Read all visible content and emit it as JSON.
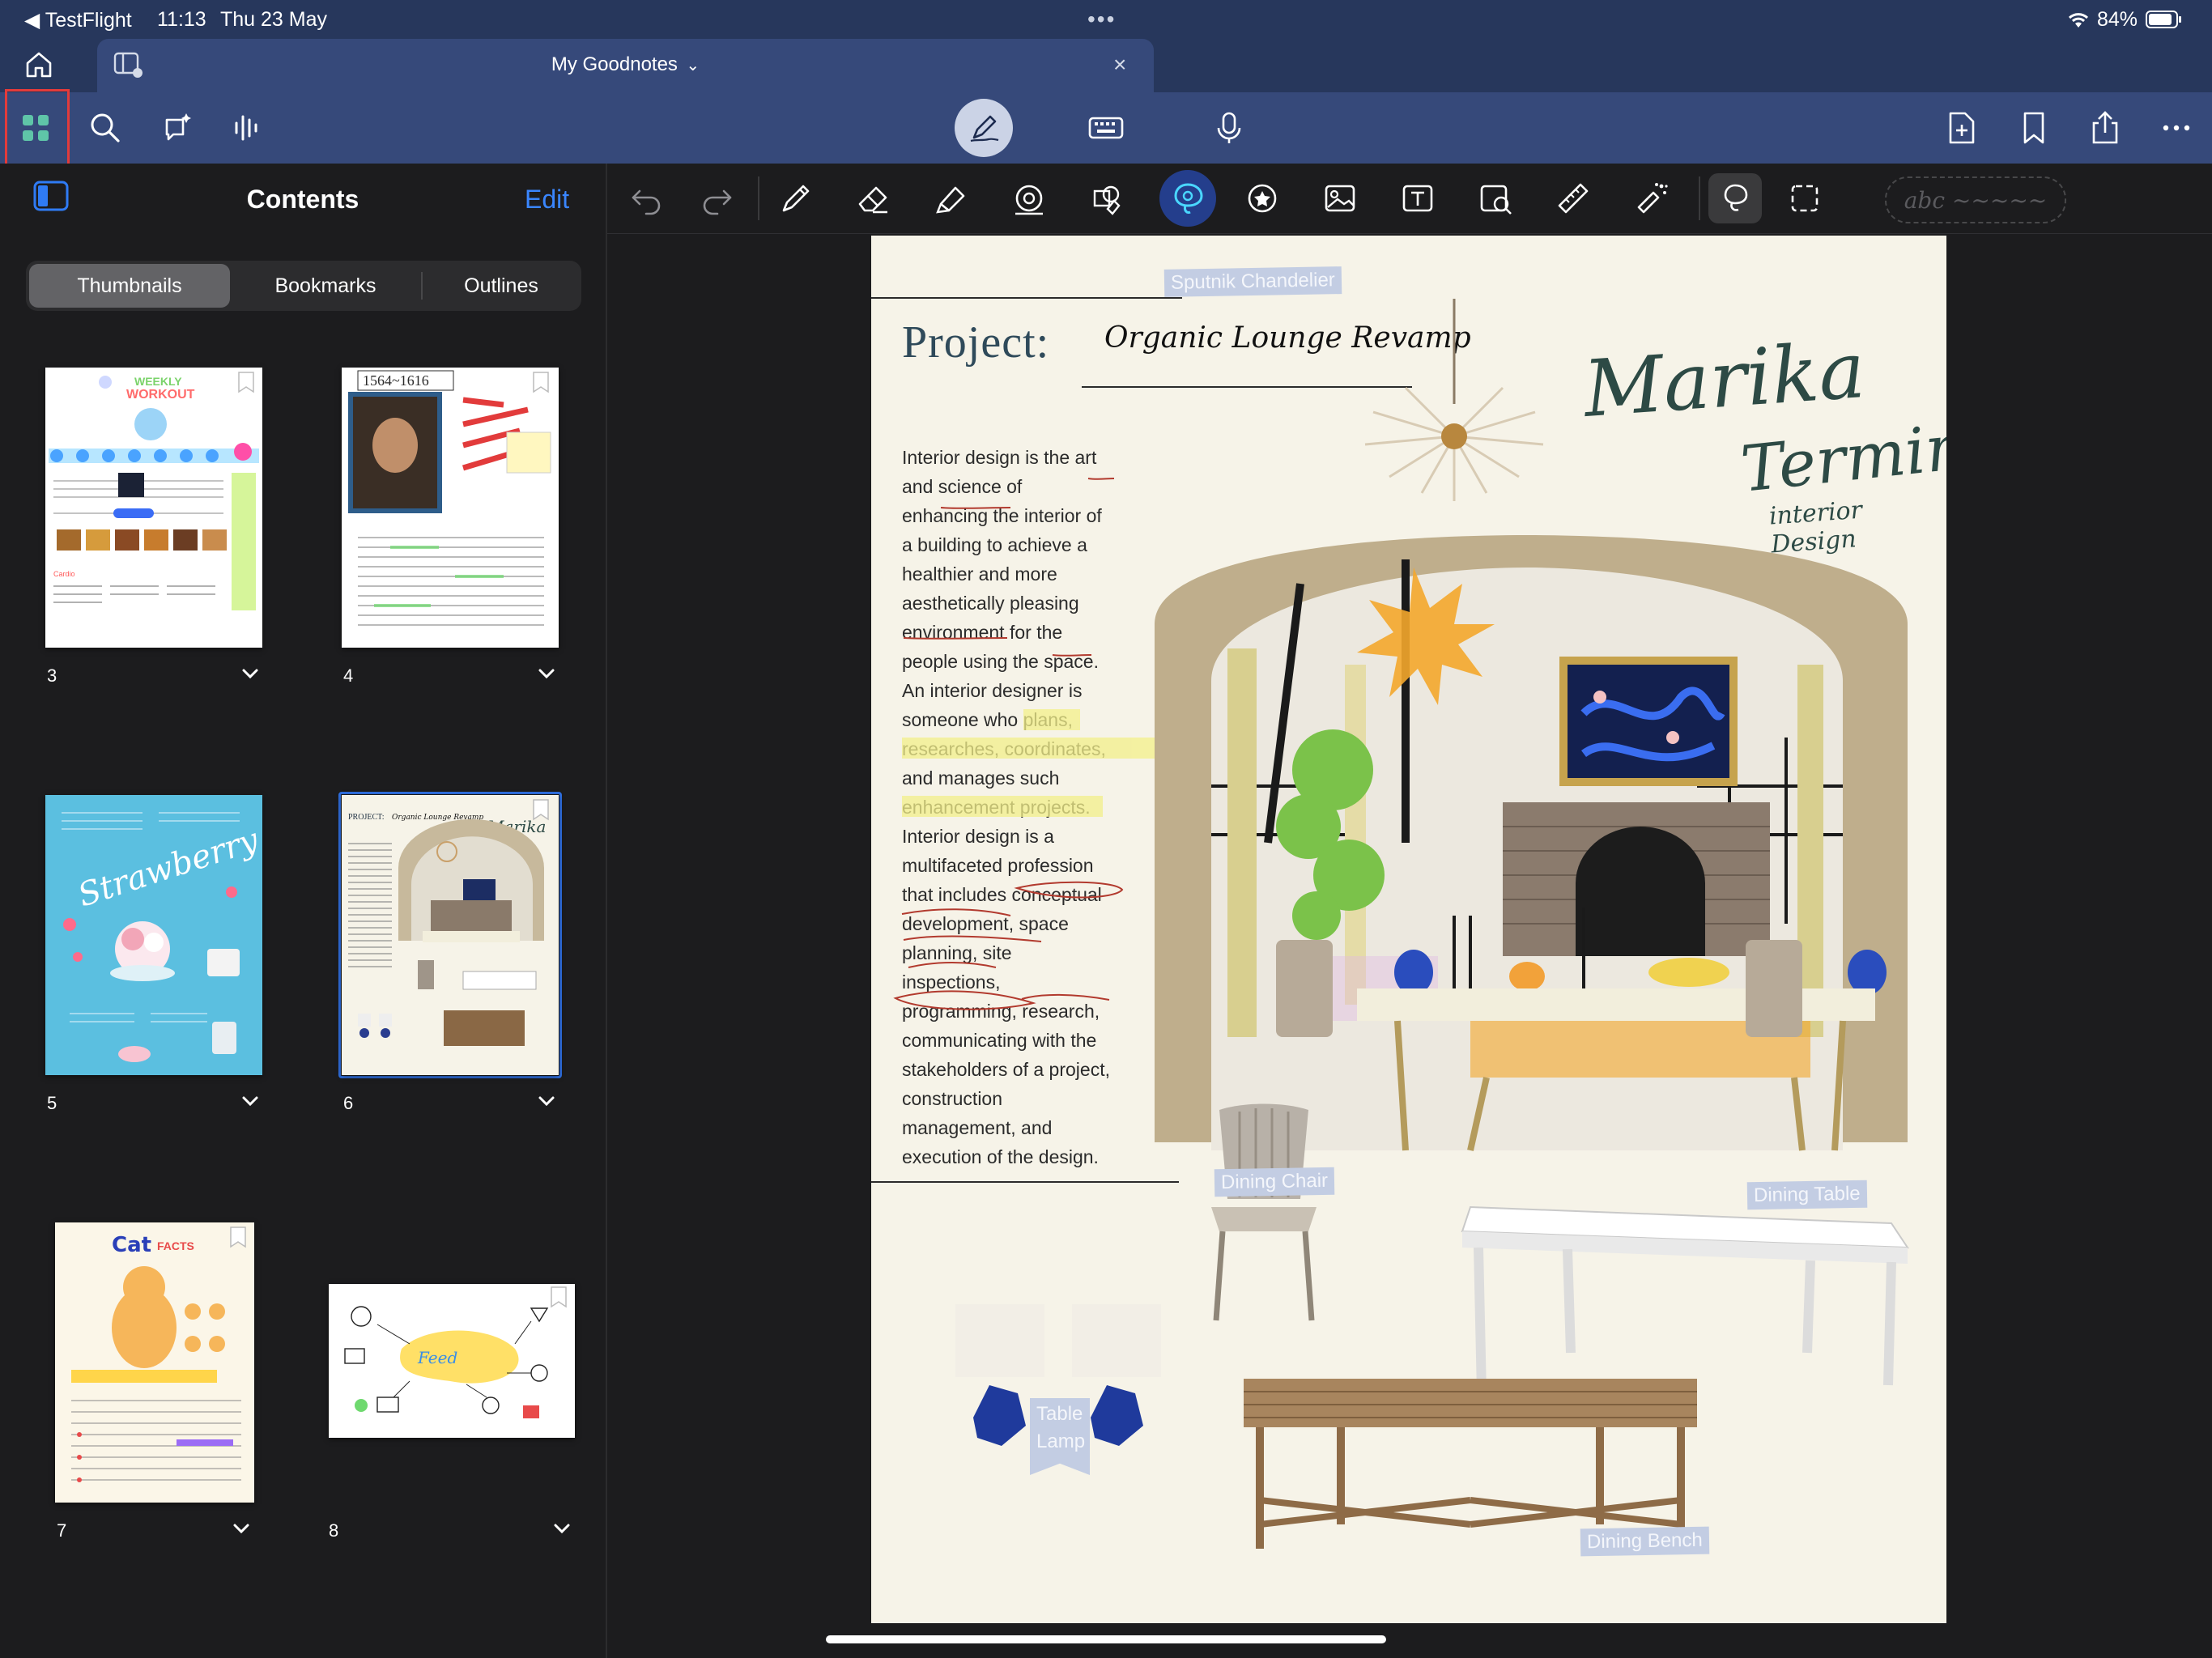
{
  "status_bar": {
    "back_app": "TestFlight",
    "time": "11:13",
    "date": "Thu 23 May",
    "battery": "84%"
  },
  "tab": {
    "title": "My Goodnotes"
  },
  "sidebar": {
    "title": "Contents",
    "edit_label": "Edit",
    "segments": [
      "Thumbnails",
      "Bookmarks",
      "Outlines"
    ],
    "selected_segment": "Thumbnails",
    "pages": [
      {
        "number": "3"
      },
      {
        "number": "4",
        "thumb_text": "1564~1616"
      },
      {
        "number": "5"
      },
      {
        "number": "6"
      },
      {
        "number": "7",
        "thumb_text": "Cat FACTS"
      },
      {
        "number": "8"
      }
    ],
    "selected_page": "6"
  },
  "canvas_toolbar": {
    "ink_placeholder": "abc ~~~~~"
  },
  "page": {
    "project_label": "Project:",
    "project_title": "Organic Lounge Revamp",
    "designer_name_1": "Marika",
    "designer_name_2": "Termine",
    "designer_subtitle": "interior Design",
    "body": "Interior design is the art\nand science of\nenhancing the interior of\na building to achieve a\nhealthier and more\naesthetically pleasing\nenvironment for the\npeople using the space.\nAn interior designer is\nsomeone who plans,\nresearches, coordinates,\nand manages such\nenhancement projects.\nInterior design is a\nmultifaceted profession\nthat includes conceptual\ndevelopment, space\nplanning, site\ninspections,\nprogramming, research,\ncommunicating with the\nstakeholders of a project,\nconstruction\nmanagement, and\nexecution of the design.",
    "labels": {
      "chandelier": "Sputnik Chandelier",
      "chair": "Dining Chair",
      "table": "Dining Table",
      "lamp": "Table Lamp",
      "bench": "Dining Bench"
    }
  },
  "colors": {
    "nav_dark": "#27375c",
    "nav": "#36497a",
    "accent": "#2f6fe0",
    "highlight": "#f3f08a",
    "paper": "#f6f3e8"
  }
}
